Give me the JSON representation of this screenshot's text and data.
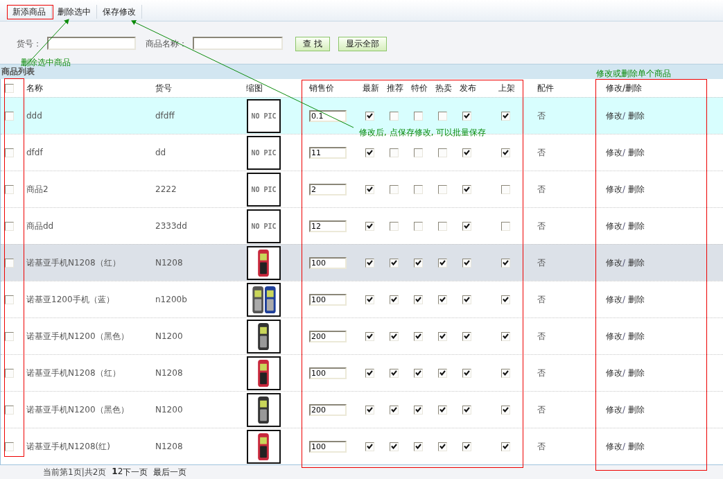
{
  "toolbar": [
    {
      "label": "新添商品"
    },
    {
      "label": "删除选中"
    },
    {
      "label": "保存修改"
    }
  ],
  "search": {
    "fields": [
      {
        "label": "货号："
      },
      {
        "label": "商品名称："
      }
    ],
    "buttons": [
      "查 找",
      "显示全部"
    ]
  },
  "section_title": "商品列表",
  "table": {
    "select_all": {
      "checked": false
    },
    "columns": [
      "名称",
      "货号",
      "缩图",
      "销售价",
      "最新",
      "推荐",
      "特价",
      "热卖",
      "发布",
      "上架",
      "配件",
      "修改/删除"
    ],
    "rows": [
      {
        "checked": false,
        "hovered": true,
        "shaded": false,
        "name": "ddd",
        "code": "dfdff",
        "thumb": {
          "kind": "no_pic",
          "text": "NO PIC"
        },
        "price": "0.1",
        "flags": [
          {
            "checked": true
          },
          {
            "checked": false
          },
          {
            "checked": false
          },
          {
            "checked": false
          },
          {
            "checked": true
          },
          {
            "checked": true
          }
        ],
        "accessory": "否",
        "edit": "修改",
        "separator": "/",
        "delete": "删除"
      },
      {
        "checked": false,
        "hovered": false,
        "shaded": false,
        "name": "dfdf",
        "code": "dd",
        "thumb": {
          "kind": "no_pic",
          "text": "NO PIC"
        },
        "price": "11",
        "flags": [
          {
            "checked": true
          },
          {
            "checked": false
          },
          {
            "checked": false
          },
          {
            "checked": false
          },
          {
            "checked": true
          },
          {
            "checked": true
          }
        ],
        "accessory": "否",
        "edit": "修改",
        "separator": "/",
        "delete": "删除"
      },
      {
        "checked": false,
        "hovered": false,
        "shaded": false,
        "name": "商品2",
        "code": "2222",
        "thumb": {
          "kind": "no_pic",
          "text": "NO PIC"
        },
        "price": "2",
        "flags": [
          {
            "checked": true
          },
          {
            "checked": false
          },
          {
            "checked": false
          },
          {
            "checked": false
          },
          {
            "checked": true
          },
          {
            "checked": false
          }
        ],
        "accessory": "否",
        "edit": "修改",
        "separator": "/",
        "delete": "删除"
      },
      {
        "checked": false,
        "hovered": false,
        "shaded": false,
        "name": "商品dd",
        "code": "2333dd",
        "thumb": {
          "kind": "no_pic",
          "text": "NO PIC"
        },
        "price": "12",
        "flags": [
          {
            "checked": true
          },
          {
            "checked": false
          },
          {
            "checked": false
          },
          {
            "checked": false
          },
          {
            "checked": true
          },
          {
            "checked": false
          }
        ],
        "accessory": "否",
        "edit": "修改",
        "separator": "/",
        "delete": "删除"
      },
      {
        "checked": false,
        "hovered": false,
        "shaded": true,
        "name": "诺基亚手机N1208（红）",
        "code": "N1208",
        "price": "100",
        "flags": [
          {
            "checked": true
          },
          {
            "checked": true
          },
          {
            "checked": true
          },
          {
            "checked": true
          },
          {
            "checked": true
          },
          {
            "checked": true
          }
        ],
        "accessory": "否",
        "edit": "修改",
        "separator": "/",
        "delete": "删除"
      },
      {
        "checked": false,
        "hovered": false,
        "shaded": false,
        "name": "诺基亚1200手机（蓝）",
        "code": "n1200b",
        "price": "100",
        "flags": [
          {
            "checked": true
          },
          {
            "checked": true
          },
          {
            "checked": true
          },
          {
            "checked": true
          },
          {
            "checked": true
          },
          {
            "checked": true
          }
        ],
        "accessory": "否",
        "edit": "修改",
        "separator": "/",
        "delete": "删除"
      },
      {
        "checked": false,
        "hovered": false,
        "shaded": false,
        "name": "诺基亚手机N1200（黑色）",
        "code": "N1200",
        "price": "200",
        "flags": [
          {
            "checked": true
          },
          {
            "checked": true
          },
          {
            "checked": true
          },
          {
            "checked": true
          },
          {
            "checked": true
          },
          {
            "checked": true
          }
        ],
        "accessory": "否",
        "edit": "修改",
        "separator": "/",
        "delete": "删除"
      },
      {
        "checked": false,
        "hovered": false,
        "shaded": false,
        "name": "诺基亚手机N1208（红）",
        "code": "N1208",
        "price": "100",
        "flags": [
          {
            "checked": true
          },
          {
            "checked": true
          },
          {
            "checked": true
          },
          {
            "checked": true
          },
          {
            "checked": true
          },
          {
            "checked": true
          }
        ],
        "accessory": "否",
        "edit": "修改",
        "separator": "/",
        "delete": "删除"
      },
      {
        "checked": false,
        "hovered": false,
        "shaded": false,
        "name": "诺基亚手机N1200（黑色）",
        "code": "N1200",
        "price": "200",
        "flags": [
          {
            "checked": true
          },
          {
            "checked": true
          },
          {
            "checked": true
          },
          {
            "checked": true
          },
          {
            "checked": true
          },
          {
            "checked": true
          }
        ],
        "accessory": "否",
        "edit": "修改",
        "separator": "/",
        "delete": "删除"
      },
      {
        "checked": false,
        "hovered": false,
        "shaded": false,
        "name": "诺基亚手机N1208(红)",
        "code": "N1208",
        "price": "100",
        "flags": [
          {
            "checked": true
          },
          {
            "checked": true
          },
          {
            "checked": true
          },
          {
            "checked": true
          },
          {
            "checked": true
          },
          {
            "checked": true
          }
        ],
        "accessory": "否",
        "edit": "修改",
        "separator": "/",
        "delete": "删除"
      }
    ]
  },
  "pagination": {
    "info": "当前第1页|共2页",
    "pages": [
      {
        "label": "1",
        "selected": true
      },
      {
        "label": "2",
        "selected": false
      }
    ],
    "links": [
      "下一页",
      "最后一页"
    ]
  },
  "annotations": [
    {
      "text": "删除选中商品"
    },
    {
      "text": "修改后, 点保存修改, 可以批量保存"
    },
    {
      "text": "修改或删除单个商品"
    }
  ]
}
